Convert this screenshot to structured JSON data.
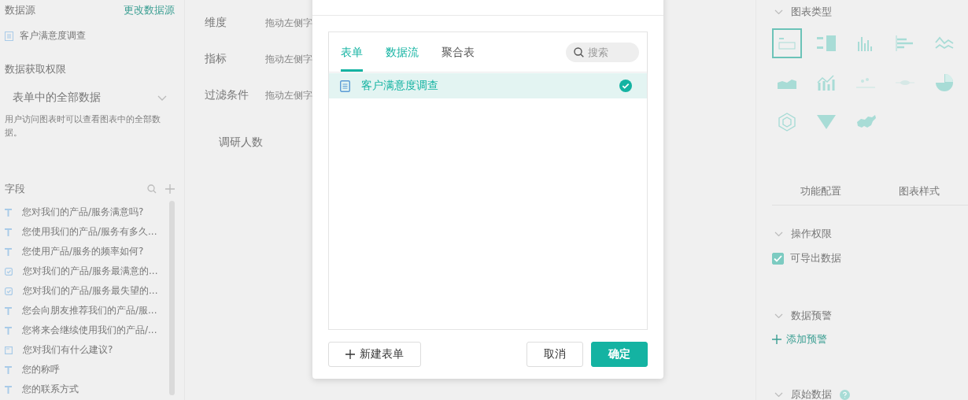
{
  "left_panel": {
    "datasource_title": "数据源",
    "change_link": "更改数据源",
    "datasource_item": "客户满意度调查",
    "permission_title": "数据获取权限",
    "permission_select": "表单中的全部数据",
    "permission_desc": "用户访问图表时可以查看图表中的全部数据。",
    "fields_title": "字段",
    "fields": [
      {
        "kind": "text",
        "label": "您对我们的产品/服务满意吗?"
      },
      {
        "kind": "text",
        "label": "您使用我们的产品/服务有多久..."
      },
      {
        "kind": "text",
        "label": "您使用产品/服务的频率如何?"
      },
      {
        "kind": "checkbox",
        "label": "您对我们的产品/服务最满意的..."
      },
      {
        "kind": "checkbox",
        "label": "您对我们的产品/服务最失望的..."
      },
      {
        "kind": "text",
        "label": "您会向朋友推荐我们的产品/服..."
      },
      {
        "kind": "text",
        "label": "您将来会继续使用我们的产品/..."
      },
      {
        "kind": "textarea",
        "label": "您对我们有什么建议?"
      },
      {
        "kind": "text",
        "label": "您的称呼"
      },
      {
        "kind": "text",
        "label": "您的联系方式"
      }
    ]
  },
  "center_panel": {
    "slots": [
      {
        "label": "维度",
        "placeholder": "拖动左侧字"
      },
      {
        "label": "指标",
        "placeholder": "拖动左侧字"
      },
      {
        "label": "过滤条件",
        "placeholder": "拖动左侧字"
      }
    ],
    "chart_title": "调研人数"
  },
  "right_panel": {
    "chart_type_title": "图表类型",
    "chart_types": [
      {
        "kind": "number",
        "selected": true
      },
      {
        "kind": "table",
        "selected": false
      },
      {
        "kind": "column",
        "selected": false
      },
      {
        "kind": "bar",
        "selected": false
      },
      {
        "kind": "line",
        "selected": false
      },
      {
        "kind": "area",
        "selected": false
      },
      {
        "kind": "combo",
        "selected": false
      },
      {
        "kind": "scatter",
        "selected": false
      },
      {
        "kind": "flow",
        "selected": false
      },
      {
        "kind": "pie",
        "selected": false
      },
      {
        "kind": "radar",
        "selected": false
      },
      {
        "kind": "funnel",
        "selected": false
      },
      {
        "kind": "map",
        "selected": false
      }
    ],
    "tabs": [
      {
        "label": "功能配置",
        "selected": false
      },
      {
        "label": "图表样式",
        "selected": false
      }
    ],
    "operation_title": "操作权限",
    "export_checkbox": {
      "label": "可导出数据",
      "checked": true
    },
    "alert_title": "数据预警",
    "add_alert": "添加预警",
    "raw_data_title": "原始数据"
  },
  "dialog": {
    "tabs": [
      {
        "label": "表单",
        "selected": true,
        "hovered": false
      },
      {
        "label": "数据流",
        "selected": false,
        "hovered": true
      },
      {
        "label": "聚合表",
        "selected": false,
        "hovered": false
      }
    ],
    "search": {
      "placeholder": "搜索"
    },
    "items": [
      {
        "label": "客户满意度调查",
        "selected": true
      }
    ],
    "new_button": "新建表单",
    "cancel_button": "取消",
    "confirm_button": "确定"
  }
}
